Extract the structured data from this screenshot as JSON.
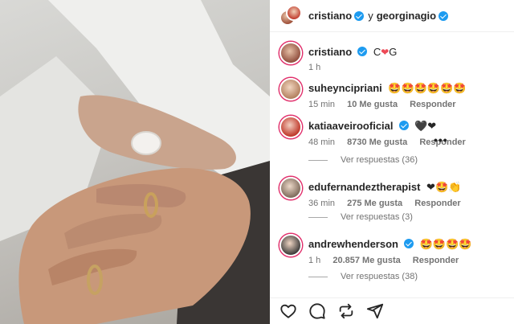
{
  "header": {
    "user1": "cristiano",
    "connector": "y",
    "user2": "georginagio"
  },
  "caption": {
    "username": "cristiano",
    "text_left": "C",
    "text_right": "G",
    "time": "1 h"
  },
  "comments": [
    {
      "username": "suheyncipriani",
      "text": "🤩🤩🤩🤩🤩🤩",
      "time": "15 min",
      "likes": "10 Me gusta",
      "reply": "Responder"
    },
    {
      "username": "katiaaveirooficial",
      "text": "🖤❤",
      "time": "48 min",
      "likes": "8730 Me gusta",
      "reply": "Responder",
      "more": "•••",
      "view_replies": "Ver respuestas (36)"
    },
    {
      "username": "edufernandeztherapist",
      "text": "❤🤩👏",
      "time": "36 min",
      "likes": "275 Me gusta",
      "reply": "Responder",
      "view_replies": "Ver respuestas (3)"
    },
    {
      "username": "andrewhenderson",
      "text": "🤩🤩🤩🤩",
      "time": "1 h",
      "likes": "20.857 Me gusta",
      "reply": "Responder",
      "view_replies": "Ver respuestas (38)"
    }
  ],
  "actions": [
    "heart-icon",
    "comment-icon",
    "repost-icon",
    "share-icon"
  ],
  "colors": {
    "verified": "#1d9bf0",
    "like_heart": "#ed4956",
    "meta_text": "#737373"
  }
}
